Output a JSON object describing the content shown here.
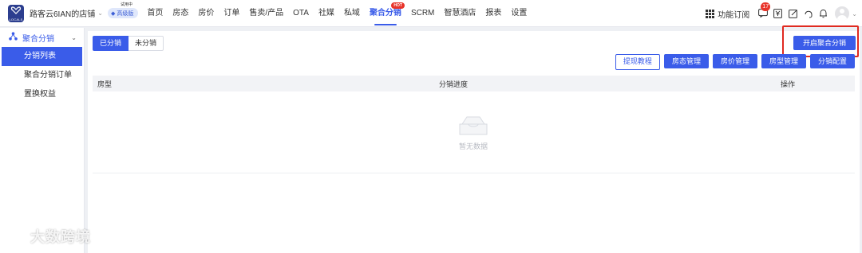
{
  "topbar": {
    "logo_text": "LOCALS",
    "store_name": "路客云6IAN的店铺",
    "plan_label": "高级版",
    "trial_label": "试用中",
    "nav": [
      {
        "label": "首页"
      },
      {
        "label": "房态"
      },
      {
        "label": "房价"
      },
      {
        "label": "订单"
      },
      {
        "label": "售卖/产品"
      },
      {
        "label": "OTA"
      },
      {
        "label": "社媒"
      },
      {
        "label": "私域"
      },
      {
        "label": "聚合分销",
        "active": true,
        "tag": "HOT"
      },
      {
        "label": "SCRM"
      },
      {
        "label": "智慧酒店"
      },
      {
        "label": "报表"
      },
      {
        "label": "设置"
      }
    ],
    "func_subscribe": "功能订阅",
    "message_count": "17"
  },
  "sidebar": {
    "group_label": "聚合分销",
    "items": [
      {
        "label": "分销列表",
        "active": true
      },
      {
        "label": "聚合分销订单"
      },
      {
        "label": "置换权益"
      }
    ]
  },
  "main": {
    "segments": {
      "distributed": "已分销",
      "not_distributed": "未分销"
    },
    "open_button": "开启聚合分销",
    "actions": {
      "tutorial": "提现教程",
      "room_status": "房态管理",
      "room_price": "房价管理",
      "room_type": "房型管理",
      "distribution_config": "分销配置"
    },
    "table": {
      "headers": {
        "room_type": "房型",
        "progress": "分销进度",
        "operation": "操作"
      },
      "empty_text": "暂无数据"
    }
  },
  "watermark": {
    "text": "大数跨境"
  },
  "colors": {
    "primary": "#3a5ce9",
    "highlight": "#e02a20",
    "hot": "#e8342a"
  }
}
